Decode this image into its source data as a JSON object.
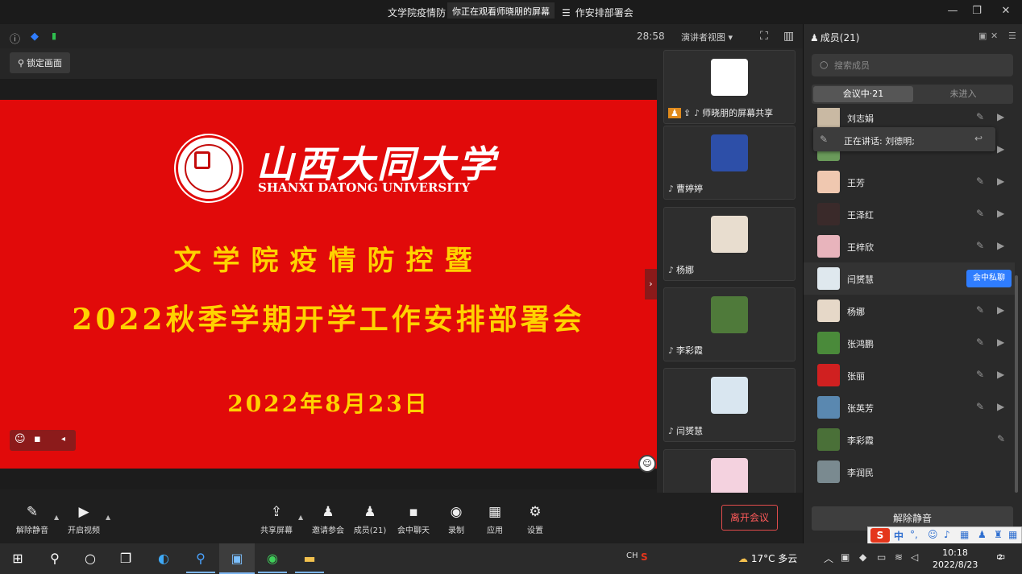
{
  "titlebar": {
    "title_prefix": "文学院疫情防",
    "sharing_tip": "你正在观看师晓朋的屏幕",
    "list_icon": "☰",
    "title_suffix": "作安排部署会",
    "minimize": "—",
    "restore": "❐",
    "close": "✕"
  },
  "infobar": {
    "timer": "28:58",
    "view_mode": "演讲者视图",
    "icons": {
      "info": "ⓘ",
      "shield": "◆",
      "signal": "▮",
      "fullscreen": "⛶",
      "layout": "▥"
    }
  },
  "stage": {
    "lock_label": "锁定画面",
    "lock_icon": "⚲"
  },
  "slide": {
    "university_cn": "山西大同大学",
    "university_en": "SHANXI DATONG UNIVERSITY",
    "title_line1": "文学院疫情防控暨",
    "title_line2": "2022秋季学期开学工作安排部署会",
    "date": "2022年8月23日"
  },
  "reaction": {
    "emoji": "☺",
    "chat": "▪",
    "collapse": "◂"
  },
  "thumbnails": [
    {
      "name": "师晓朋的屏幕共享",
      "badge": "♟",
      "share_icon": "⇪",
      "color": "#ffffff"
    },
    {
      "name": "曹婷婷",
      "color": "#2d4fa8"
    },
    {
      "name": "杨娜",
      "color": "#e8ddcf"
    },
    {
      "name": "李彩霞",
      "color": "#4f7a3a"
    },
    {
      "name": "闫赟慧",
      "color": "#d9e6f0"
    },
    {
      "name": "",
      "color": "#f4d2df"
    }
  ],
  "panel": {
    "title": "成员(21)",
    "search_placeholder": "搜索成员",
    "tab_in_meeting": "会议中·21",
    "tab_not_joined": "未进入",
    "speaking_text": "正在讲话: 刘德明;",
    "private_chat_label": "会中私聊",
    "unmute_all": "解除静音",
    "members": [
      {
        "name": "刘志娟",
        "color": "#c9b9a3"
      },
      {
        "name": "",
        "color": "#6a9a5a"
      },
      {
        "name": "王芳",
        "color": "#f0c8b0"
      },
      {
        "name": "王泽红",
        "color": "#3a2a2a"
      },
      {
        "name": "王梓欣",
        "color": "#e8b4bc"
      },
      {
        "name": "闫赟慧",
        "color": "#dfe8ee"
      },
      {
        "name": "杨娜",
        "color": "#e6d8c8"
      },
      {
        "name": "张鸿鹏",
        "color": "#4a8a3a"
      },
      {
        "name": "张丽",
        "color": "#d02020"
      },
      {
        "name": "张英芳",
        "color": "#5a88b0"
      },
      {
        "name": "李彩霞",
        "color": "#4a7038"
      },
      {
        "name": "李润民",
        "color": "#7a8a90"
      }
    ]
  },
  "toolbar": {
    "unmute": "解除静音",
    "start_video": "开启视频",
    "share_screen": "共享屏幕",
    "invite": "邀请参会",
    "members": "成员(21)",
    "chat": "会中聊天",
    "record": "录制",
    "apps": "应用",
    "settings": "设置",
    "leave": "离开会议"
  },
  "ime": {
    "logo": "S",
    "lang": "中"
  },
  "taskbar": {
    "weather": "17°C 多云",
    "ime_label": "CH",
    "time": "10:18",
    "date": "2022/8/23",
    "notifications": "2"
  }
}
